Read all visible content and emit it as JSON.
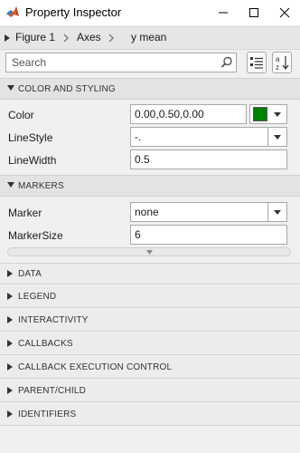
{
  "window": {
    "title": "Property Inspector",
    "icon": "matlab-logo-icon"
  },
  "breadcrumb": [
    "Figure 1",
    "Axes",
    "y mean"
  ],
  "search": {
    "placeholder": "Search",
    "value": ""
  },
  "toolbar": {
    "grouped_view_icon": "list-grouped-icon",
    "sort_icon": "sort-az-icon"
  },
  "sections": {
    "color_styling": {
      "title": "COLOR AND STYLING",
      "color_label": "Color",
      "color_value": "0.00,0.50,0.00",
      "color_swatch": "#008000",
      "linestyle_label": "LineStyle",
      "linestyle_value": "-.",
      "linewidth_label": "LineWidth",
      "linewidth_value": "0.5"
    },
    "markers": {
      "title": "MARKERS",
      "marker_label": "Marker",
      "marker_value": "none",
      "markersize_label": "MarkerSize",
      "markersize_value": "6"
    },
    "collapsed": [
      "DATA",
      "LEGEND",
      "INTERACTIVITY",
      "CALLBACKS",
      "CALLBACK EXECUTION CONTROL",
      "PARENT/CHILD",
      "IDENTIFIERS"
    ]
  }
}
